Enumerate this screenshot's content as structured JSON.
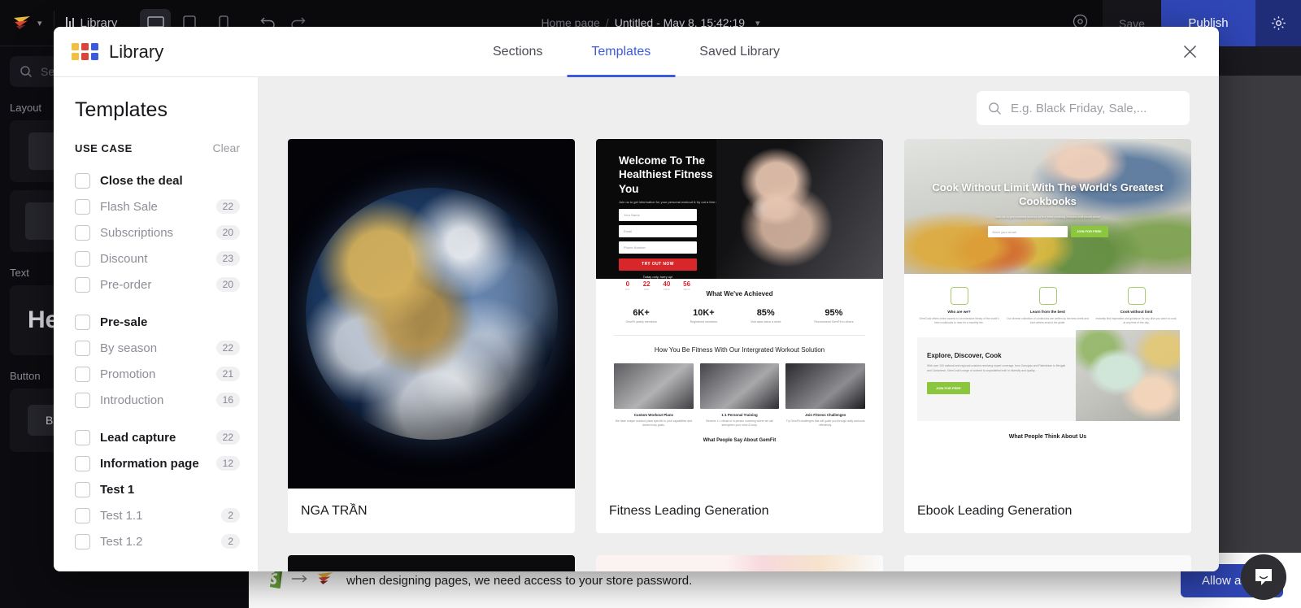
{
  "app": {
    "topbar": {
      "logo_icon": "gempages-logo-icon",
      "chevron_icon": "chevron-down-icon",
      "library_label": "Library",
      "devices": [
        {
          "name": "desktop",
          "icon": "desktop-icon",
          "active": true
        },
        {
          "name": "tablet",
          "icon": "tablet-icon",
          "active": false
        },
        {
          "name": "mobile",
          "icon": "mobile-icon",
          "active": false
        }
      ],
      "undo_icon": "undo-icon",
      "redo_icon": "redo-icon",
      "breadcrumb_parent": "Home page",
      "breadcrumb_sep": "/",
      "breadcrumb_current": "Untitled - May 8, 15:42:19",
      "breadcrumb_chevron_icon": "chevron-down-icon",
      "preview_icon": "eye-icon",
      "save_label": "Save",
      "publish_label": "Publish",
      "settings_icon": "gear-icon"
    },
    "sidebar": {
      "search_placeholder": "Se",
      "search_icon": "search-icon",
      "groups": [
        {
          "label": "Layout"
        },
        {
          "label": "Text",
          "sample": "Hea"
        },
        {
          "label": "Button",
          "sample": "Bu"
        }
      ]
    },
    "notice": {
      "shopify_icon": "shopify-icon",
      "arrow_icon": "arrow-right-icon",
      "gempages_icon": "gempages-logo-icon",
      "text": "when designing pages, we need access to your store password.",
      "allow_label": "Allow access"
    },
    "chat_icon": "chat-bubble-icon"
  },
  "modal": {
    "logo_icon": "grid-logo-icon",
    "title": "Library",
    "close_icon": "close-icon",
    "tabs": [
      {
        "label": "Sections",
        "active": false
      },
      {
        "label": "Templates",
        "active": true
      },
      {
        "label": "Saved Library",
        "active": false
      }
    ],
    "sidebar": {
      "heading": "Templates",
      "use_case_label": "USE CASE",
      "clear_label": "Clear",
      "filters": [
        {
          "label": "Close the deal",
          "count": "",
          "parent": true,
          "gap_before": false
        },
        {
          "label": "Flash Sale",
          "count": "22",
          "parent": false,
          "gap_before": false
        },
        {
          "label": "Subscriptions",
          "count": "20",
          "parent": false,
          "gap_before": false
        },
        {
          "label": "Discount",
          "count": "23",
          "parent": false,
          "gap_before": false
        },
        {
          "label": "Pre-order",
          "count": "20",
          "parent": false,
          "gap_before": false
        },
        {
          "label": "Pre-sale",
          "count": "",
          "parent": true,
          "gap_before": true
        },
        {
          "label": "By season",
          "count": "22",
          "parent": false,
          "gap_before": false
        },
        {
          "label": "Promotion",
          "count": "21",
          "parent": false,
          "gap_before": false
        },
        {
          "label": "Introduction",
          "count": "16",
          "parent": false,
          "gap_before": false
        },
        {
          "label": "Lead capture",
          "count": "22",
          "parent": true,
          "gap_before": true
        },
        {
          "label": "Information page",
          "count": "12",
          "parent": true,
          "gap_before": false
        },
        {
          "label": "Test 1",
          "count": "",
          "parent": true,
          "gap_before": false
        },
        {
          "label": "Test 1.1",
          "count": "2",
          "parent": false,
          "gap_before": false
        },
        {
          "label": "Test 1.2",
          "count": "2",
          "parent": false,
          "gap_before": false
        }
      ]
    },
    "search": {
      "icon": "search-icon",
      "placeholder": "E.g. Black Friday, Sale,..."
    },
    "cards": [
      {
        "title": "NGA TRẦN",
        "thumb": "earth-photo"
      },
      {
        "title": "Fitness Leading Generation",
        "thumb": "fitness-landing-page",
        "hero_heading": "Welcome To The Healthiest Fitness You",
        "hero_sub": "Join us to get information for your personal workout & try out a free class",
        "fields": [
          "Your Name",
          "Email",
          "Phone Number"
        ],
        "cta": "TRY OUT NOW",
        "hurry": "Today only, hurry up!",
        "countdown": [
          {
            "value": "0",
            "unit": "DAY"
          },
          {
            "value": "22",
            "unit": "HRS"
          },
          {
            "value": "40",
            "unit": "MINS"
          },
          {
            "value": "56",
            "unit": "SECS"
          }
        ],
        "achieved_heading": "What We've Achieved",
        "stats": [
          {
            "value": "6K+",
            "label": "GemFit yearly members"
          },
          {
            "value": "10K+",
            "label": "Registered members"
          },
          {
            "value": "85%",
            "label": "Visit class twice a week"
          },
          {
            "value": "95%",
            "label": "Recommend GemFit to others"
          }
        ],
        "solution_heading": "How You Be Fitness With Our Intergrated Workout Solution",
        "features": [
          {
            "title": "Custom Workout Plans",
            "desc": "We have unique workout plans specific to your capabilities and dream body goals."
          },
          {
            "title": "1:1 Personal Training",
            "desc": "Receive 1:1 virtual or in-person coaching where we will strengthen your mind & body."
          },
          {
            "title": "Join Fitness Challenges",
            "desc": "Try GemFit challenges that will guide you through daily workouts effectively."
          }
        ],
        "footer_heading": "What People Say About GemFit"
      },
      {
        "title": "Ebook Leading Generation",
        "thumb": "ebook-landing-page",
        "hero_heading": "Cook Without Limit With The World's Greatest Cookbooks",
        "hero_sub": "Join us to get curated access to the best cooking ebooks and much more",
        "email_placeholder": "Enter your email",
        "cta": "JOIN FOR FREE",
        "features": [
          {
            "title": "Who are we?",
            "desc": "GemCook offers online access to an extensive library of the world's best cookbooks to read for a monthly fee."
          },
          {
            "title": "Learn from the best",
            "desc": "Our diverse collection of cookbooks are written by the best chefs and food writers around the globe."
          },
          {
            "title": "Cook without limit",
            "desc": "Instantly find inspiration and guidance for any dish you want to cook, at any time of the day."
          }
        ],
        "split_heading": "Explore, Discover, Cook",
        "split_desc": "With over 100 national and regional cuisines receiving expert coverage, from Georgian and Palestinian to Bengali and Cantonese, GemCook's range of content is unparalleled both in diversity and quality.",
        "split_cta": "JOIN FOR FREE",
        "footer_heading": "What People Think About Us"
      }
    ]
  }
}
